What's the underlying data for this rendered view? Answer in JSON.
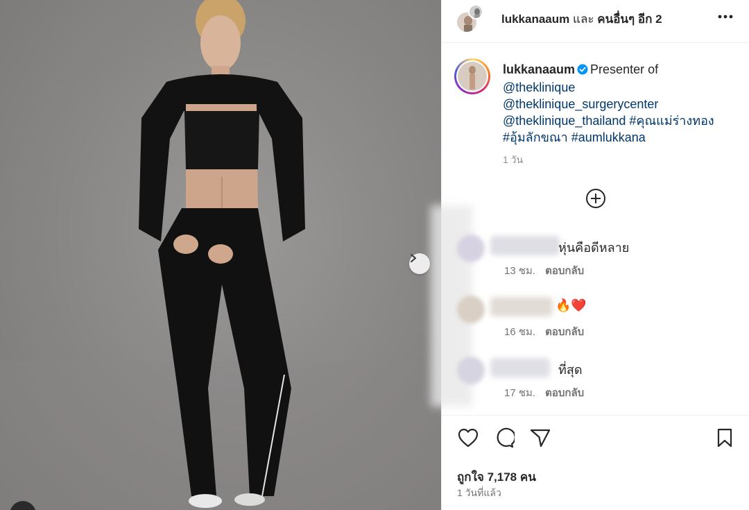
{
  "header": {
    "username": "lukkanaaum",
    "connector": " และ ",
    "others": "คนอื่นๆ อีก 2"
  },
  "caption": {
    "username": "lukkanaaum",
    "text_intro": "Presenter of",
    "mention_1": "@theklinique",
    "mention_2": "@theklinique_surgerycenter",
    "mention_3": "@theklinique_thailand",
    "hashtag_1": "#คุณแม่ร่างทอง",
    "hashtag_2": "#อุ้มลักขณา",
    "hashtag_3": "#aumlukkana",
    "time": "1 วัน"
  },
  "comments": [
    {
      "text": "หุ่นคือดีหลาย",
      "time": "13 ชม.",
      "reply_label": "ตอบกลับ"
    },
    {
      "text": "🔥❤️",
      "time": "16 ชม.",
      "reply_label": "ตอบกลับ"
    },
    {
      "text": "ที่สุด",
      "time": "17 ชม.",
      "reply_label": "ตอบกลับ"
    }
  ],
  "footer": {
    "likes": "ถูกใจ 7,178 คน",
    "posted": "1 วันที่แล้ว"
  },
  "icons": {
    "verified": "verified-badge-icon",
    "more": "more-options-icon",
    "like": "heart-icon",
    "comment": "comment-icon",
    "share": "share-icon",
    "save": "bookmark-icon",
    "load_more": "plus-circle-icon",
    "next": "chevron-right-icon"
  },
  "colors": {
    "accent_link": "#00376b",
    "verified_blue": "#0095f6",
    "muted_text": "#737373"
  }
}
